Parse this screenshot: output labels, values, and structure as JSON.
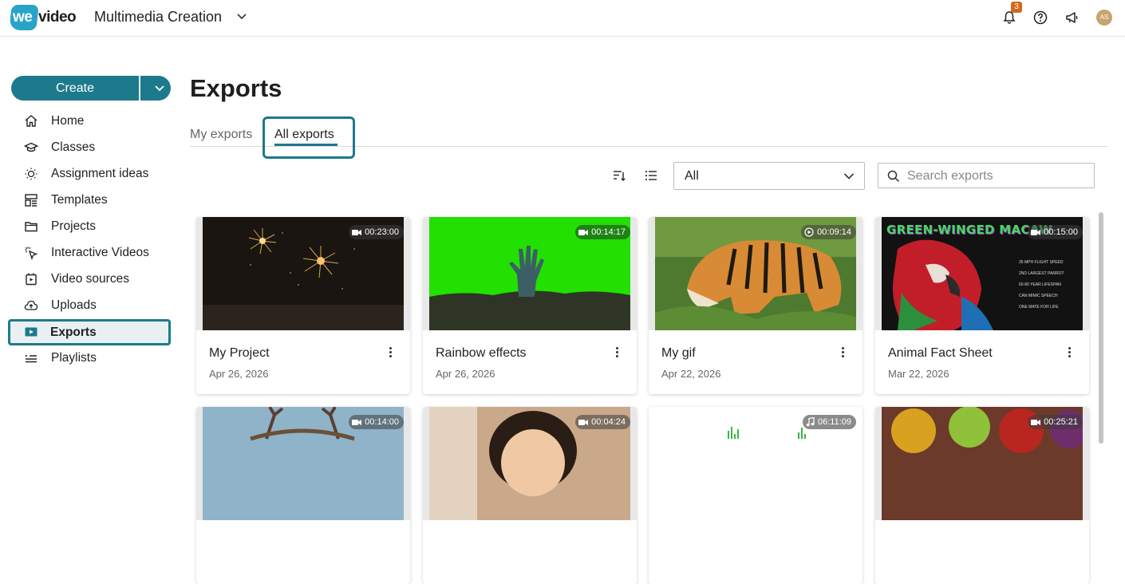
{
  "app": {
    "logo_we": "we",
    "logo_video": "video",
    "workspace": "Multimedia Creation",
    "notifications_count": "3",
    "avatar_initials": "AS"
  },
  "sidebar": {
    "create_label": "Create",
    "items": [
      {
        "label": "Home",
        "icon": "home-icon"
      },
      {
        "label": "Classes",
        "icon": "classes-icon"
      },
      {
        "label": "Assignment ideas",
        "icon": "lightbulb-icon"
      },
      {
        "label": "Templates",
        "icon": "templates-icon"
      },
      {
        "label": "Projects",
        "icon": "folder-icon"
      },
      {
        "label": "Interactive Videos",
        "icon": "interactive-icon"
      },
      {
        "label": "Video sources",
        "icon": "video-sources-icon"
      },
      {
        "label": "Uploads",
        "icon": "upload-icon"
      },
      {
        "label": "Exports",
        "icon": "exports-icon",
        "active": true
      },
      {
        "label": "Playlists",
        "icon": "playlist-icon"
      }
    ]
  },
  "main": {
    "title": "Exports",
    "tabs": [
      {
        "label": "My exports",
        "active": false
      },
      {
        "label": "All exports",
        "active": true
      }
    ],
    "filter_value": "All",
    "search_placeholder": "Search exports",
    "cards": [
      {
        "title": "My Project",
        "date": "Apr 26, 2026",
        "duration": "00:23:00",
        "type": "video"
      },
      {
        "title": "Rainbow effects",
        "date": "Apr 26, 2026",
        "duration": "00:14:17",
        "type": "video"
      },
      {
        "title": "My gif",
        "date": "Apr 22, 2026",
        "duration": "00:09:14",
        "type": "gif"
      },
      {
        "title": "Animal Fact Sheet",
        "date": "Mar 22, 2026",
        "duration": "00:15:00",
        "type": "video"
      },
      {
        "title": "",
        "date": "",
        "duration": "00:14:00",
        "type": "video"
      },
      {
        "title": "",
        "date": "",
        "duration": "00:04:24",
        "type": "video"
      },
      {
        "title": "",
        "date": "",
        "duration": "06:11:09",
        "type": "audio"
      },
      {
        "title": "",
        "date": "",
        "duration": "00:25:21",
        "type": "video"
      }
    ],
    "animal_fact_sheet_thumb": {
      "heading": "GREEN-WINGED MACAW",
      "facts": [
        "35 MPH FLIGHT SPEED",
        "2ND LARGEST PARROT",
        "60-80 YEAR LIFESPAN",
        "CAN MIMIC SPEECH",
        "ONE MATE FOR LIFE"
      ]
    }
  },
  "colors": {
    "accent": "#1d7a8c",
    "logo": "#2aa3c9",
    "notification": "#d4691c",
    "green_screen": "#22e000"
  }
}
